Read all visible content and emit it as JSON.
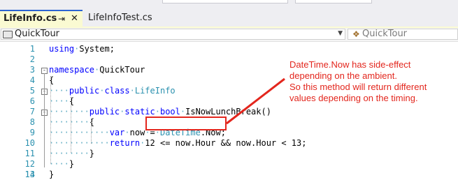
{
  "tabs": [
    {
      "label": "LifeInfo.cs",
      "active": true,
      "pin_icon": "pin-icon",
      "close_icon": "close-icon"
    },
    {
      "label": "LifeInfoTest.cs",
      "active": false
    }
  ],
  "navbar": {
    "left_combo": {
      "icon": "class-icon",
      "value": "QuickTour"
    },
    "right_combo": {
      "icon": "member-icon",
      "value": "QuickTour"
    }
  },
  "editor": {
    "lines": [
      {
        "number": "1"
      },
      {
        "number": "2"
      },
      {
        "number": "3"
      },
      {
        "number": "4"
      },
      {
        "number": "5"
      },
      {
        "number": "6"
      },
      {
        "number": "7"
      },
      {
        "number": "8"
      },
      {
        "number": "9"
      },
      {
        "number": "10"
      },
      {
        "number": "11"
      },
      {
        "number": "12"
      },
      {
        "number": "13"
      },
      {
        "number": "14"
      }
    ],
    "tokens": {
      "using": "using",
      "system": "System;",
      "namespace": "namespace",
      "ns_name": "QuickTour",
      "brace_open": "{",
      "brace_close": "}",
      "public": "public",
      "class": "class",
      "class_name": "LifeInfo",
      "static": "static",
      "bool": "bool",
      "method": "IsNowLunchBreak()",
      "var": "var",
      "now": "now",
      "equals": "=",
      "datetime": "DateTime",
      "now_prop": ".Now;",
      "return": "return",
      "expr": "12 <= now.Hour && now.Hour < 13;",
      "fold_minus": "-"
    }
  },
  "annotation": {
    "lines": [
      "DateTime.Now has side-effect",
      "depending on the ambient.",
      "So this method will return different",
      "values depending on the timing."
    ]
  },
  "colors": {
    "keyword": "#0000ff",
    "type": "#2b91af",
    "annotation_red": "#e3261d",
    "active_tab_bg": "#fafad2",
    "active_tab_accent": "#2b64d4"
  }
}
